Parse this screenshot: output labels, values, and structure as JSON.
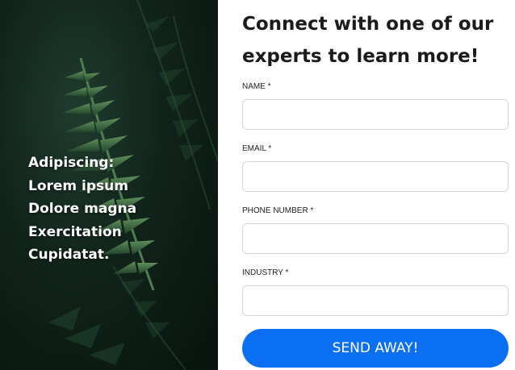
{
  "hero": {
    "lines": [
      "Adipiscing:",
      "Lorem ipsum",
      "Dolore magna",
      "Exercitation",
      "Cupidatat."
    ]
  },
  "form": {
    "heading": "Connect with one of our experts to learn more!",
    "fields": [
      {
        "label": "NAME *",
        "value": ""
      },
      {
        "label": "EMAIL *",
        "value": ""
      },
      {
        "label": "PHONE NUMBER *",
        "value": ""
      },
      {
        "label": "INDUSTRY *",
        "value": ""
      }
    ],
    "submit_label": "SEND AWAY!"
  },
  "colors": {
    "accent": "#0b6ff2",
    "heading": "#1b1b1b",
    "input_border": "#d5d5d5"
  }
}
